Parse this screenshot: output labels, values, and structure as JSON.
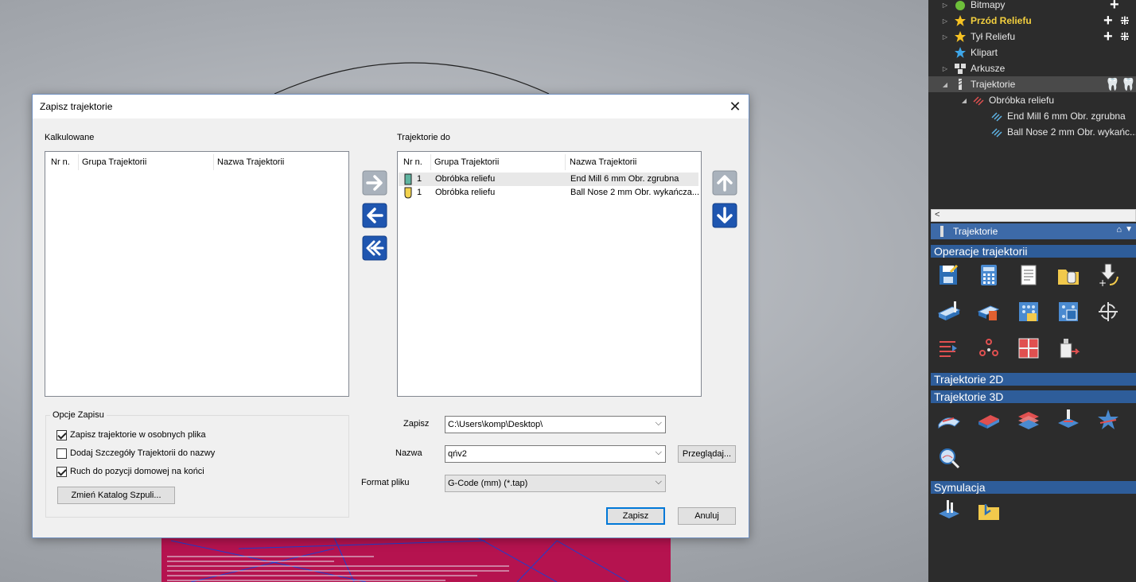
{
  "dialog": {
    "title": "Zapisz trajektorie",
    "calculated_label": "Kalkulowane",
    "calculated_columns": [
      "Nr n.",
      "Grupa Trajektorii",
      "Nazwa Trajektorii"
    ],
    "target_label": "Trajektorie do",
    "target_columns": [
      "Nr n.",
      "Grupa Trajektorii",
      "Nazwa Trajektorii"
    ],
    "target_rows": [
      {
        "nr": "1",
        "group": "Obróbka reliefu",
        "name": "End Mill 6 mm Obr. zgrubna"
      },
      {
        "nr": "1",
        "group": "Obróbka reliefu",
        "name": "Ball Nose 2 mm Obr. wykańcza..."
      }
    ],
    "options_title": "Opcje Zapisu",
    "options": [
      {
        "label": "Zapisz trajektorie w osobnych plika",
        "checked": true
      },
      {
        "label": "Dodaj Szczegóły Trajektorii do nazwy",
        "checked": false
      },
      {
        "label": "Ruch do pozycji domowej na końci",
        "checked": true
      }
    ],
    "change_folder_button": "Zmień Katalog Szpuli...",
    "save_in_label": "Zapisz",
    "save_in_value": "C:\\Users\\komp\\Desktop\\",
    "name_label": "Nazwa",
    "name_value": "qńv2",
    "browse_button": "Przeglądaj...",
    "format_label": "Format pliku",
    "format_value": "G-Code (mm) (*.tap)",
    "save_button": "Zapisz",
    "cancel_button": "Anuluj"
  },
  "tree": {
    "items": [
      {
        "label": "Bitmapy"
      },
      {
        "label": "Przód Reliefu"
      },
      {
        "label": "Tył Reliefu"
      },
      {
        "label": "Klipart"
      },
      {
        "label": "Arkusze"
      },
      {
        "label": "Trajektorie"
      },
      {
        "label": "Obróbka reliefu"
      },
      {
        "label": "End Mill 6 mm Obr. zgrubna"
      },
      {
        "label": "Ball Nose 2 mm Obr. wykańc..."
      }
    ],
    "scroll_left": "<"
  },
  "panel": {
    "title": "Trajektorie",
    "sections": {
      "operations": "Operacje trajektorii",
      "toolpaths_2d": "Trajektorie 2D",
      "toolpaths_3d": "Trajektorie 3D",
      "simulation": "Symulacja"
    }
  }
}
